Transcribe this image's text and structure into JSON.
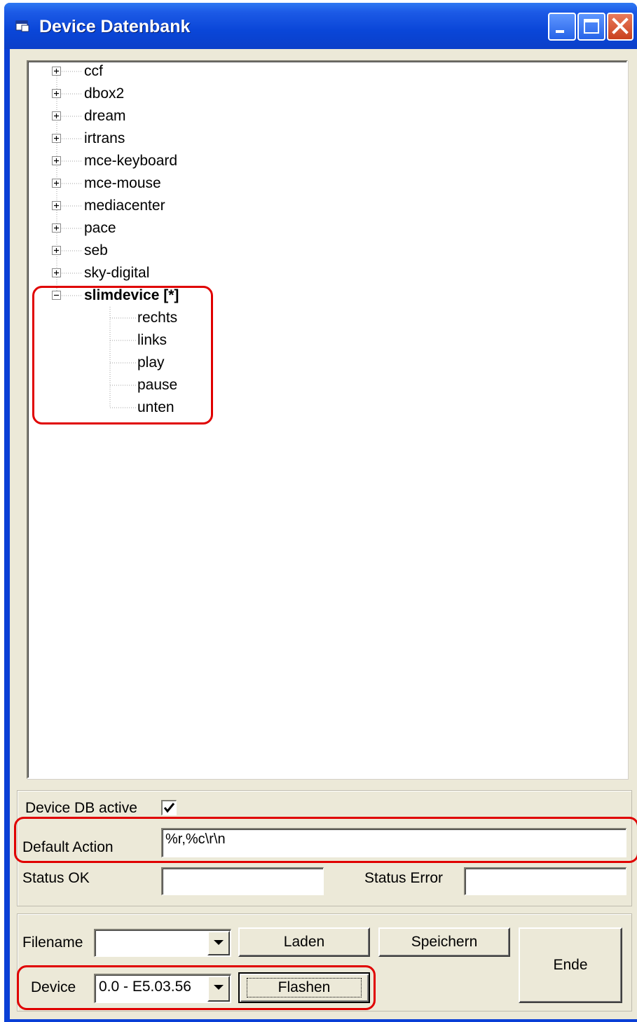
{
  "window": {
    "title": "Device Datenbank",
    "icon": "app-window-icon"
  },
  "titlebar_buttons": [
    {
      "name": "minimize",
      "icon": "minimize-icon"
    },
    {
      "name": "maximize",
      "icon": "maximize-icon"
    },
    {
      "name": "close",
      "icon": "close-icon"
    }
  ],
  "tree": {
    "nodes": [
      {
        "label": "ccf",
        "expander": "+"
      },
      {
        "label": "dbox2",
        "expander": "+"
      },
      {
        "label": "dream",
        "expander": "+"
      },
      {
        "label": "irtrans",
        "expander": "+"
      },
      {
        "label": "mce-keyboard",
        "expander": "+"
      },
      {
        "label": "mce-mouse",
        "expander": "+"
      },
      {
        "label": "mediacenter",
        "expander": "+"
      },
      {
        "label": "pace",
        "expander": "+"
      },
      {
        "label": "seb",
        "expander": "+"
      },
      {
        "label": "sky-digital",
        "expander": "+"
      },
      {
        "label": "slimdevice [*]",
        "expander": "−",
        "expanded": true,
        "bold": true
      }
    ],
    "children": [
      "rechts",
      "links",
      "play",
      "pause",
      "unten"
    ]
  },
  "settings": {
    "device_db_active_label": "Device DB active",
    "device_db_active_checked": true,
    "default_action_label": "Default Action",
    "default_action_value": "%r,%c\\r\\n",
    "status_ok_label": "Status OK",
    "status_ok_value": "",
    "status_error_label": "Status Error",
    "status_error_value": ""
  },
  "file": {
    "filename_label": "Filename",
    "filename_value": "",
    "load_button": "Laden",
    "save_button": "Speichern",
    "end_button": "Ende",
    "device_label": "Device",
    "device_value": "0.0 - E5.03.56",
    "flash_button": "Flashen"
  },
  "colors": {
    "titlebar": "#0a46d8",
    "face": "#ece9d8",
    "highlight": "#e00000"
  }
}
